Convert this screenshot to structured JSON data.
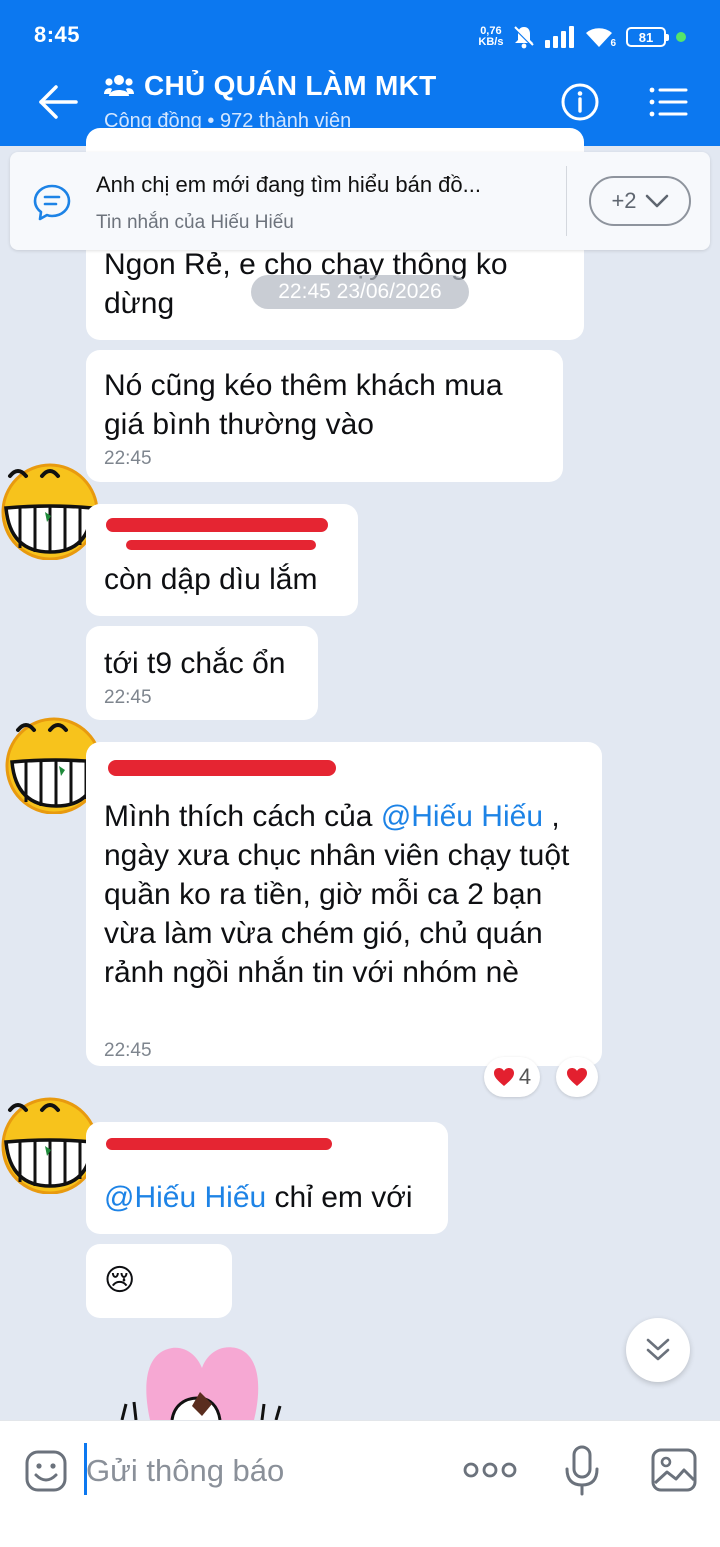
{
  "status_bar": {
    "time": "8:45",
    "net_speed_value": "0,76",
    "net_speed_unit": "KB/s",
    "signal_sub": "6",
    "battery": "81"
  },
  "header": {
    "title": "CHỦ QUÁN LÀM MKT",
    "subtitle": "Cộng đồng • 972 thành viên"
  },
  "pinned": {
    "text": "Anh chị em mới đang tìm hiểu bán đồ...",
    "sender": "Tin nhắn của Hiếu Hiếu",
    "more_label": "+2"
  },
  "date_pill": "22:45 23/06/2026",
  "messages": [
    {
      "text": "Ngon Rẻ, e cho chạy thông ko dừng"
    },
    {
      "text": "Nó cũng kéo thêm khách mua giá bình thường vào",
      "time": "22:45"
    },
    {
      "text": "còn dập dìu lắm"
    },
    {
      "text": "tới t9 chắc ổn",
      "time": "22:45"
    },
    {
      "text_before": "Mình thích cách của ",
      "mention": "@Hiếu Hiếu",
      "text_after": " , ngày xưa chục nhân viên chạy tuột quần ko ra tiền, giờ mỗi ca 2 bạn vừa làm vừa chém gió, chủ quán rảnh ngồi nhắn tin với nhóm nè",
      "time": "22:45",
      "reaction_count": "4"
    },
    {
      "mention": "@Hiếu Hiếu",
      "text_after": " chỉ em với"
    },
    {
      "emoji": "😢"
    }
  ],
  "composer": {
    "placeholder": "Gửi thông báo"
  },
  "colors": {
    "brand": "#0c78f0",
    "mention": "#1d83e6",
    "background": "#e2e8f2",
    "redaction": "#e52532"
  },
  "icons": [
    "back-arrow-icon",
    "group-icon",
    "info-icon",
    "menu-icon",
    "pinned-chat-icon",
    "chevron-down-icon",
    "heart-icon",
    "scroll-down-icon",
    "sticker-icon",
    "more-dots-icon",
    "mic-icon",
    "image-icon"
  ]
}
